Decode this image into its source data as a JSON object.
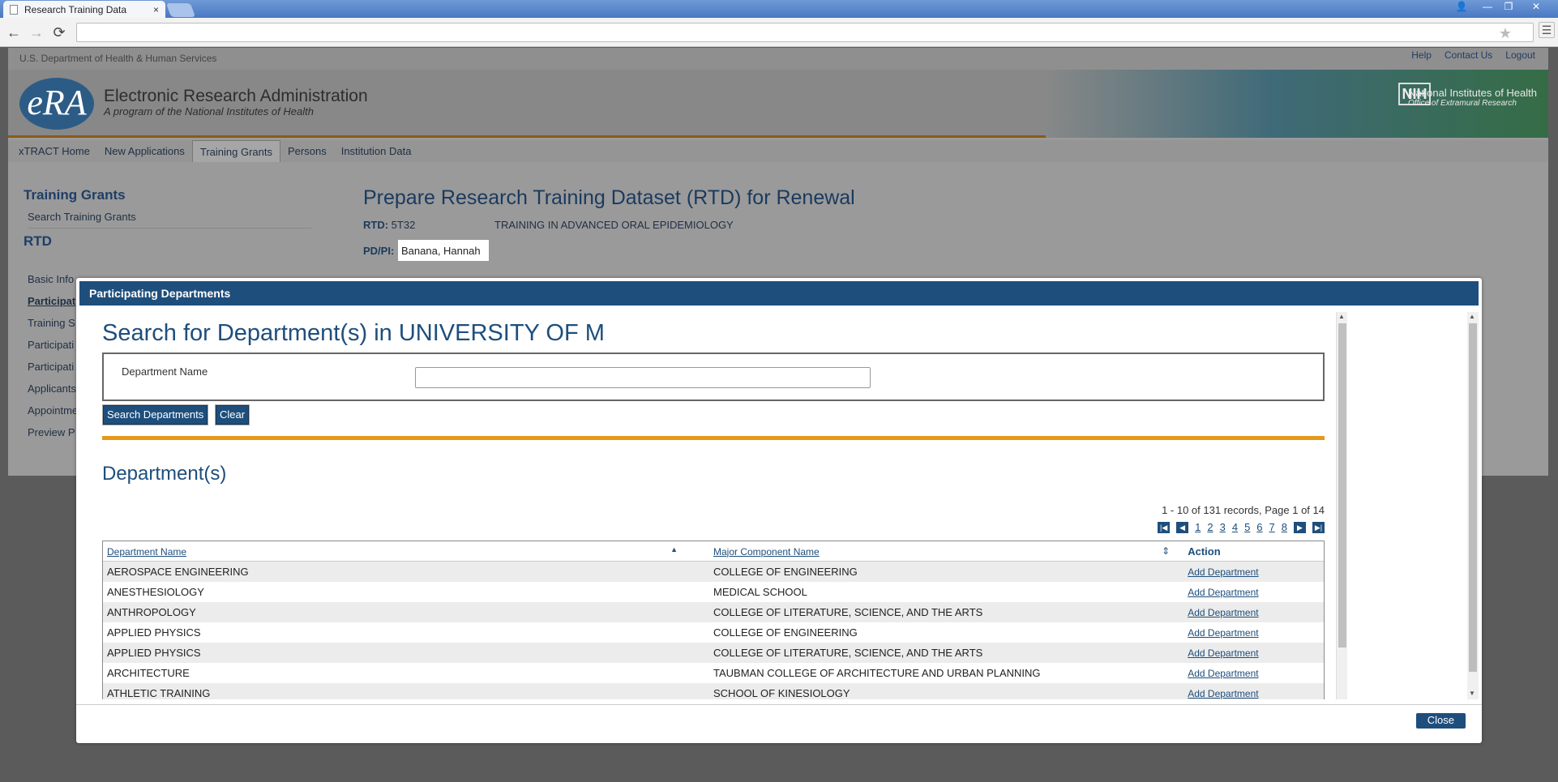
{
  "browser": {
    "tab_title": "Research Training Data",
    "tab_close": "×",
    "win_user": "👤",
    "win_min": "—",
    "win_restore": "❐",
    "win_close": "✕",
    "back": "←",
    "forward": "→",
    "reload": "⟳",
    "star": "★",
    "menu": "☰"
  },
  "header": {
    "hhs": "U.S. Department of Health & Human Services",
    "links": [
      "Help",
      "Contact Us",
      "Logout"
    ],
    "era_logo": "eRA",
    "title": "Electronic Research Administration",
    "subtitle": "A program of the National Institutes of Health",
    "nih_logo": "NIH",
    "nih_name": "National Institutes of Health",
    "nih_office": "Office of Extramural Research"
  },
  "nav": {
    "items": [
      "xTRACT Home",
      "New Applications",
      "Training Grants",
      "Persons",
      "Institution Data"
    ],
    "active": "Training Grants"
  },
  "sidebar": {
    "title": "Training Grants",
    "search": "Search Training Grants",
    "rtd_heading": "RTD",
    "items": [
      "Basic Info",
      "Participat",
      "Training S",
      "Participati",
      "Participati",
      "Applicants",
      "Appointme",
      "Preview P"
    ]
  },
  "main": {
    "title": "Prepare Research Training Dataset (RTD) for Renewal",
    "rtd_label": "RTD:",
    "rtd_value": "5T32",
    "rtd_name": "TRAINING IN ADVANCED ORAL EPIDEMIOLOGY",
    "pdpi_label": "PD/PI:",
    "pdpi_value": "Banana, Hannah"
  },
  "modal": {
    "title": "Participating Departments",
    "search_heading": "Search for Department(s) in UNIVERSITY OF M",
    "dept_label": "Department Name",
    "dept_value": "",
    "search_button": "Search Departments",
    "clear_button": "Clear",
    "results_heading": "Department(s)",
    "records_info": "1 - 10 of 131 records, Page 1 of 14",
    "pages": [
      "1",
      "2",
      "3",
      "4",
      "5",
      "6",
      "7",
      "8"
    ],
    "columns": [
      "Department Name",
      "Major Component Name",
      "Action"
    ],
    "sort_asc": "▲",
    "sort_both": "⇕",
    "rows": [
      {
        "dept": "AEROSPACE ENGINEERING",
        "component": "COLLEGE OF ENGINEERING",
        "action": "Add Department"
      },
      {
        "dept": "ANESTHESIOLOGY",
        "component": "MEDICAL SCHOOL",
        "action": "Add Department"
      },
      {
        "dept": "ANTHROPOLOGY",
        "component": "COLLEGE OF LITERATURE, SCIENCE, AND THE ARTS",
        "action": "Add Department"
      },
      {
        "dept": "APPLIED PHYSICS",
        "component": "COLLEGE OF ENGINEERING",
        "action": "Add Department"
      },
      {
        "dept": "APPLIED PHYSICS",
        "component": "COLLEGE OF LITERATURE, SCIENCE, AND THE ARTS",
        "action": "Add Department"
      },
      {
        "dept": "ARCHITECTURE",
        "component": "TAUBMAN COLLEGE OF ARCHITECTURE AND URBAN PLANNING",
        "action": "Add Department"
      },
      {
        "dept": "ATHLETIC TRAINING",
        "component": "SCHOOL OF KINESIOLOGY",
        "action": "Add Department"
      }
    ],
    "close_button": "Close"
  }
}
